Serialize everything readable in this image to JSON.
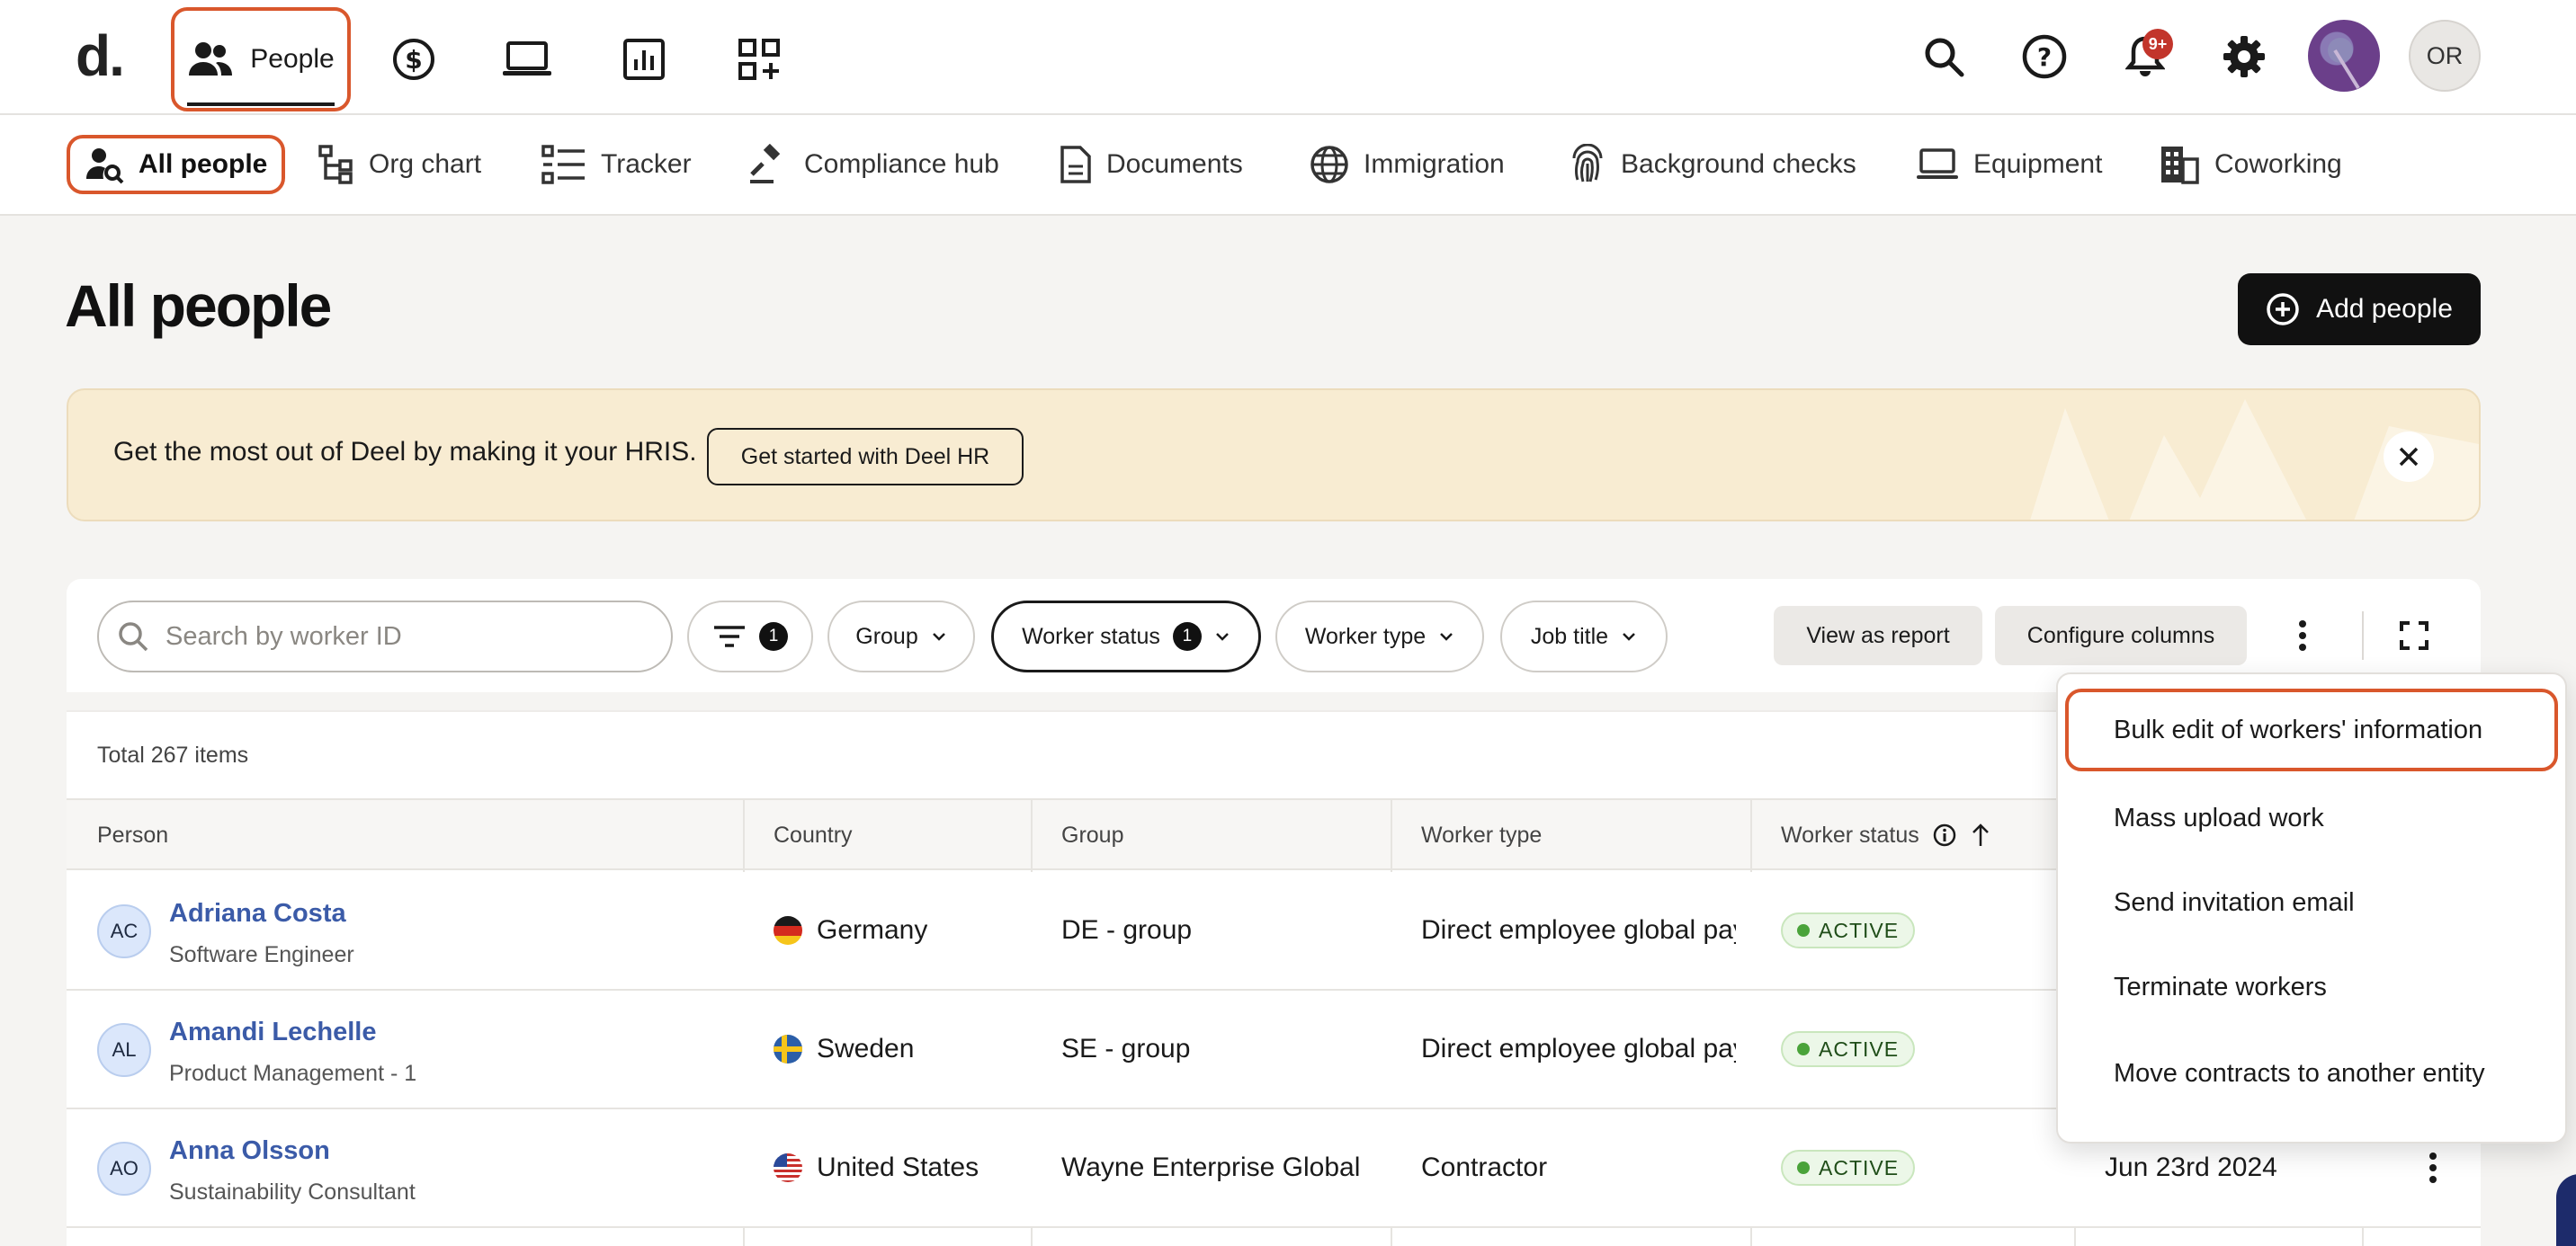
{
  "topnav": {
    "logo": "d.",
    "people_label": "People",
    "icons": [
      "people-icon",
      "payroll-dollar-icon",
      "laptop-icon",
      "reports-chart-icon",
      "apps-grid-icon"
    ],
    "right_icons": [
      "search-icon",
      "help-icon",
      "bell-icon",
      "gear-icon"
    ],
    "notification_count": "9+",
    "user_initials": "OR"
  },
  "subnav": {
    "items": [
      {
        "label": "All people",
        "icon": "person-search-icon"
      },
      {
        "label": "Org chart",
        "icon": "org-chart-icon"
      },
      {
        "label": "Tracker",
        "icon": "tracker-icon"
      },
      {
        "label": "Compliance hub",
        "icon": "gavel-icon"
      },
      {
        "label": "Documents",
        "icon": "document-icon"
      },
      {
        "label": "Immigration",
        "icon": "globe-icon"
      },
      {
        "label": "Background checks",
        "icon": "fingerprint-icon"
      },
      {
        "label": "Equipment",
        "icon": "laptop-icon"
      },
      {
        "label": "Coworking",
        "icon": "building-icon"
      }
    ]
  },
  "page": {
    "title": "All people",
    "add_button": "Add people"
  },
  "banner": {
    "text": "Get the most out of Deel by making it your HRIS.",
    "button": "Get started with Deel HR"
  },
  "filters": {
    "search_placeholder": "Search by worker ID",
    "filter_count": "1",
    "group_label": "Group",
    "worker_status_label": "Worker status",
    "worker_status_count": "1",
    "worker_type_label": "Worker type",
    "job_title_label": "Job title",
    "view_as_report": "View as report",
    "configure_columns": "Configure columns"
  },
  "table": {
    "total": "Total 267 items",
    "columns": [
      "Person",
      "Country",
      "Group",
      "Worker type",
      "Worker status"
    ],
    "rows": [
      {
        "initials": "AC",
        "name": "Adriana Costa",
        "title": "Software Engineer",
        "country": "Germany",
        "flag": "de",
        "group": "DE - group",
        "worker_type": "Direct employee global payroll",
        "status": "ACTIVE",
        "date": ""
      },
      {
        "initials": "AL",
        "name": "Amandi Lechelle",
        "title": "Product Management - 1",
        "country": "Sweden",
        "flag": "se",
        "group": "SE - group",
        "worker_type": "Direct employee global payroll",
        "status": "ACTIVE",
        "date": ""
      },
      {
        "initials": "AO",
        "name": "Anna Olsson",
        "title": "Sustainability Consultant",
        "country": "United States",
        "flag": "us",
        "group": "Wayne Enterprise Global",
        "worker_type": "Contractor",
        "status": "ACTIVE",
        "date": "Jun 23rd 2024"
      }
    ]
  },
  "menu": {
    "items": [
      "Bulk edit of workers' information",
      "Mass upload work",
      "Send invitation email",
      "Terminate workers",
      "Move contracts to another entity"
    ]
  },
  "colors": {
    "highlight": "#d9572c",
    "link": "#3b5ba8",
    "banner_bg": "#f8ecd2",
    "active_badge": "#4aa33a"
  }
}
